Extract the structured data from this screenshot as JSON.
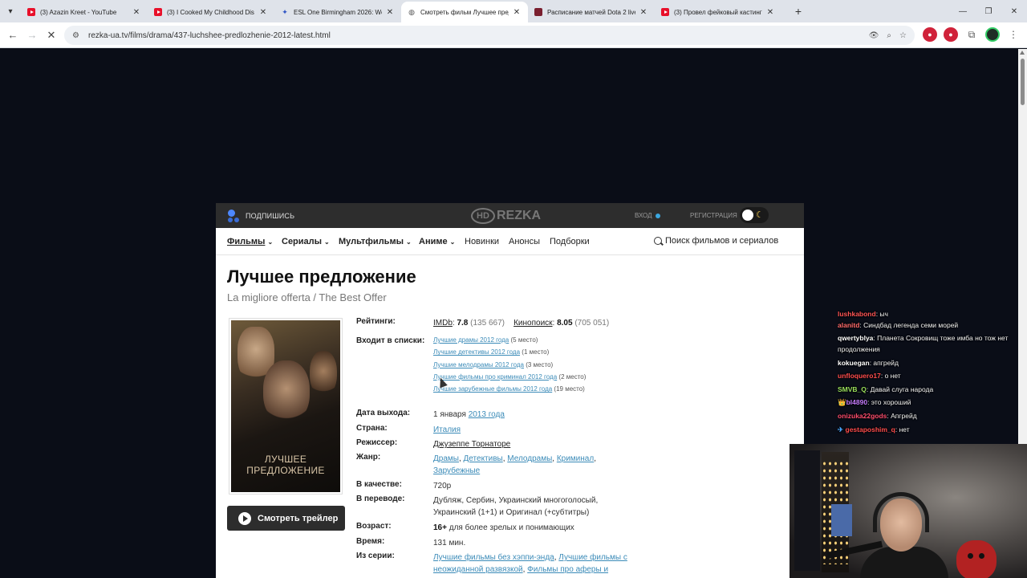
{
  "browser": {
    "tabs": [
      {
        "title": "(3) Azazin Kreet - YouTube",
        "icon": "youtube-icon",
        "active": false
      },
      {
        "title": "(3) I Cooked My Childhood Dis",
        "icon": "youtube-icon",
        "active": false
      },
      {
        "title": "ESL One Birmingham 2026: We",
        "icon": "esl-icon",
        "active": false
      },
      {
        "title": "Смотреть фильм Лучшее пред",
        "icon": "rezka-icon",
        "active": true
      },
      {
        "title": "Расписание матчей Dota 2 live",
        "icon": "cybersport-icon",
        "active": false
      },
      {
        "title": "(3) Провел фейковый кастинг",
        "icon": "youtube-icon",
        "active": false
      }
    ],
    "url": "rezka-ua.tv/films/drama/437-luchshee-predlozhenie-2012-latest.html"
  },
  "site": {
    "subscribe_label": "ПОДПИШИСЬ",
    "logo_hd": "HD",
    "logo_text": "REZKA",
    "login_label": "ВХОД",
    "register_label": "РЕГИСТРАЦИЯ",
    "nav": [
      {
        "label": "Фильмы",
        "dropdown": true,
        "current": true
      },
      {
        "label": "Сериалы",
        "dropdown": true
      },
      {
        "label": "Мультфильмы",
        "dropdown": true
      },
      {
        "label": "Аниме",
        "dropdown": true
      },
      {
        "label": "Новинки",
        "dropdown": false
      },
      {
        "label": "Анонсы",
        "dropdown": false
      },
      {
        "label": "Подборки",
        "dropdown": false
      }
    ],
    "search_placeholder": "Поиск фильмов и сериалов"
  },
  "film": {
    "title": "Лучшее предложение",
    "original_title": "La migliore offerta / The Best Offer",
    "poster_title": "ЛУЧШЕЕ ПРЕДЛОЖЕНИЕ",
    "trailer_label": "Смотреть трейлер",
    "labels": {
      "ratings": "Рейтинги:",
      "lists": "Входит в списки:",
      "release": "Дата выхода:",
      "country": "Страна:",
      "director": "Режиссер:",
      "genre": "Жанр:",
      "quality": "В качестве:",
      "translation": "В переводе:",
      "age": "Возраст:",
      "duration": "Время:",
      "series": "Из серии:"
    },
    "ratings": {
      "imdb_label": "IMDb",
      "imdb_value": "7.8",
      "imdb_votes": "(135 667)",
      "kp_label": "Кинопоиск",
      "kp_value": "8.05",
      "kp_votes": "(705 051)"
    },
    "lists": [
      {
        "name": "Лучшие драмы 2012 года",
        "place": "(5 место)"
      },
      {
        "name": "Лучшие детективы 2012 года",
        "place": "(1 место)"
      },
      {
        "name": "Лучшие мелодрамы 2012 года",
        "place": "(3 место)"
      },
      {
        "name": "Лучшие фильмы про криминал 2012 года",
        "place": "(2 место)"
      },
      {
        "name": "Лучшие зарубежные фильмы 2012 года",
        "place": "(19 место)"
      }
    ],
    "release_day": "1 января",
    "release_year": "2013 года",
    "country": "Италия",
    "director": "Джузеппе Торнаторе",
    "genres": [
      "Драмы",
      "Детективы",
      "Мелодрамы",
      "Криминал",
      "Зарубежные"
    ],
    "quality": "720p",
    "translation": "Дубляж, Сербин, Украинский многоголосый, Украинский (1+1) и Оригинал (+субтитры)",
    "age_rating": "16+",
    "age_text": "для более зрелых и понимающих",
    "duration": "131 мин.",
    "series": [
      "Лучшие фильмы без хэппи-энда",
      "Лучшие фильмы с неожиданной развязкой",
      "Фильмы про аферы и"
    ]
  },
  "chat": [
    {
      "user": "lushkabond",
      "text": ": ыч",
      "color": "#ff5555",
      "badge": ""
    },
    {
      "user": "alanitd",
      "text": ": Синдбад легенда семи морей",
      "color": "#ff6b6b",
      "badge": ""
    },
    {
      "user": "qwertyblya",
      "text": ": Планета Сокровищ тоже имба но тож нет продолжения",
      "color": "#ffffff",
      "badge": ""
    },
    {
      "user": "kokuegan",
      "text": ": апгрейд",
      "color": "#ffffff",
      "badge": ""
    },
    {
      "user": "unfloquero17",
      "text": ": о нет",
      "color": "#ff4d4d",
      "badge": ""
    },
    {
      "user": "SMVB_Q",
      "text": ": Давай слуга народа",
      "color": "#9be15d",
      "badge": ""
    },
    {
      "user": "bl4890",
      "text": ": это хороший",
      "color": "#c77dff",
      "badge": "👑"
    },
    {
      "user": "onizuka22gods",
      "text": ": Апгрейд",
      "color": "#ff4d6d",
      "badge": ""
    },
    {
      "user": "gestaposhim_q",
      "text": ": нет",
      "color": "#ff4d4d",
      "badge": "✈"
    }
  ],
  "colors": {
    "accent_link": "#3b8bb8",
    "header_dark": "#2d2d2d",
    "page_bg": "#0a0d17"
  }
}
